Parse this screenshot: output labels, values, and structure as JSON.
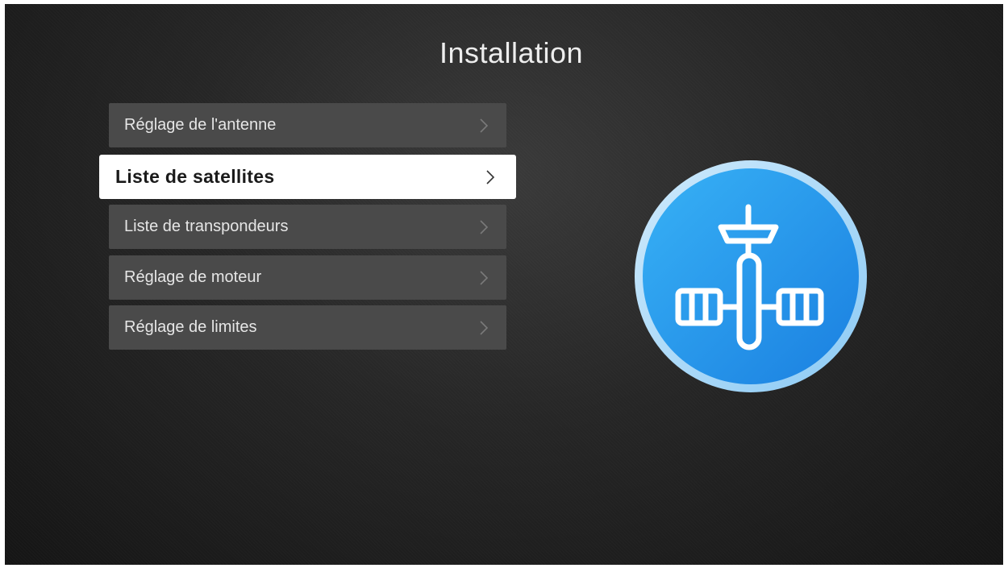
{
  "header": {
    "title": "Installation"
  },
  "menu": {
    "items": [
      {
        "label": "Réglage de l'antenne",
        "selected": false
      },
      {
        "label": "Liste de satellites",
        "selected": true
      },
      {
        "label": "Liste de transpondeurs",
        "selected": false
      },
      {
        "label": "Réglage de moteur",
        "selected": false
      },
      {
        "label": "Réglage de limites",
        "selected": false
      }
    ]
  },
  "icon": {
    "name": "satellite-icon",
    "colors": {
      "circle": "#2a9df0",
      "ring": "#a9d9fa",
      "glyph": "#ffffff"
    }
  },
  "colors": {
    "background": "#222222",
    "item_background": "#4a4a4a",
    "selected_background": "#ffffff"
  }
}
